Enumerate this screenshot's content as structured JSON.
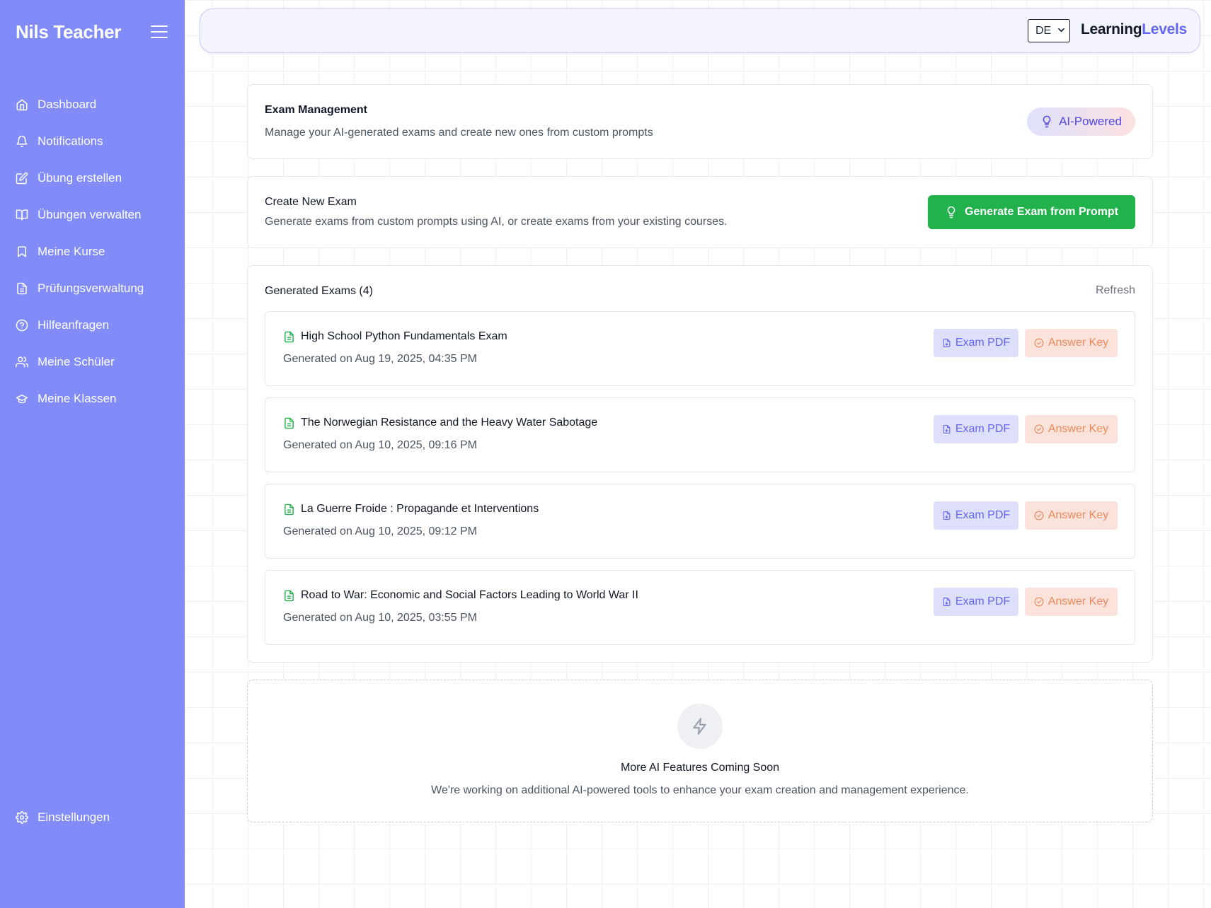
{
  "sidebar": {
    "brand": "Nils Teacher",
    "items": [
      {
        "label": "Dashboard",
        "icon": "home-icon"
      },
      {
        "label": "Notifications",
        "icon": "bell-icon"
      },
      {
        "label": "Übung erstellen",
        "icon": "edit-icon"
      },
      {
        "label": "Übungen verwalten",
        "icon": "book-open-icon"
      },
      {
        "label": "Meine Kurse",
        "icon": "bookmark-icon"
      },
      {
        "label": "Prüfungsverwaltung",
        "icon": "file-text-icon"
      },
      {
        "label": "Hilfeanfragen",
        "icon": "help-circle-icon"
      },
      {
        "label": "Meine Schüler",
        "icon": "users-icon"
      },
      {
        "label": "Meine Klassen",
        "icon": "graduation-cap-icon"
      }
    ],
    "settings_label": "Einstellungen"
  },
  "topbar": {
    "language": "DE",
    "logo_part1": "Learning",
    "logo_part2": "Levels"
  },
  "management": {
    "title": "Exam Management",
    "subtitle": "Manage your AI-generated exams and create new ones from custom prompts",
    "badge": "AI-Powered"
  },
  "create": {
    "title": "Create New Exam",
    "subtitle": "Generate exams from custom prompts using AI, or create exams from your existing courses.",
    "button": "Generate Exam from Prompt"
  },
  "generated": {
    "title": "Generated Exams (4)",
    "refresh": "Refresh",
    "pdf_label": "Exam PDF",
    "key_label": "Answer Key",
    "exams": [
      {
        "title": "High School Python Fundamentals Exam",
        "date": "Generated on Aug 19, 2025, 04:35 PM"
      },
      {
        "title": "The Norwegian Resistance and the Heavy Water Sabotage",
        "date": "Generated on Aug 10, 2025, 09:16 PM"
      },
      {
        "title": "La Guerre Froide : Propagande et Interventions",
        "date": "Generated on Aug 10, 2025, 09:12 PM"
      },
      {
        "title": "Road to War: Economic and Social Factors Leading to World War II",
        "date": "Generated on Aug 10, 2025, 03:55 PM"
      }
    ]
  },
  "coming_soon": {
    "title": "More AI Features Coming Soon",
    "subtitle": "We're working on additional AI-powered tools to enhance your exam creation and management experience."
  },
  "colors": {
    "sidebar": "#818cf8",
    "accent": "#6366f1",
    "success": "#22b24c",
    "answer_key": "#ea8a5b"
  }
}
